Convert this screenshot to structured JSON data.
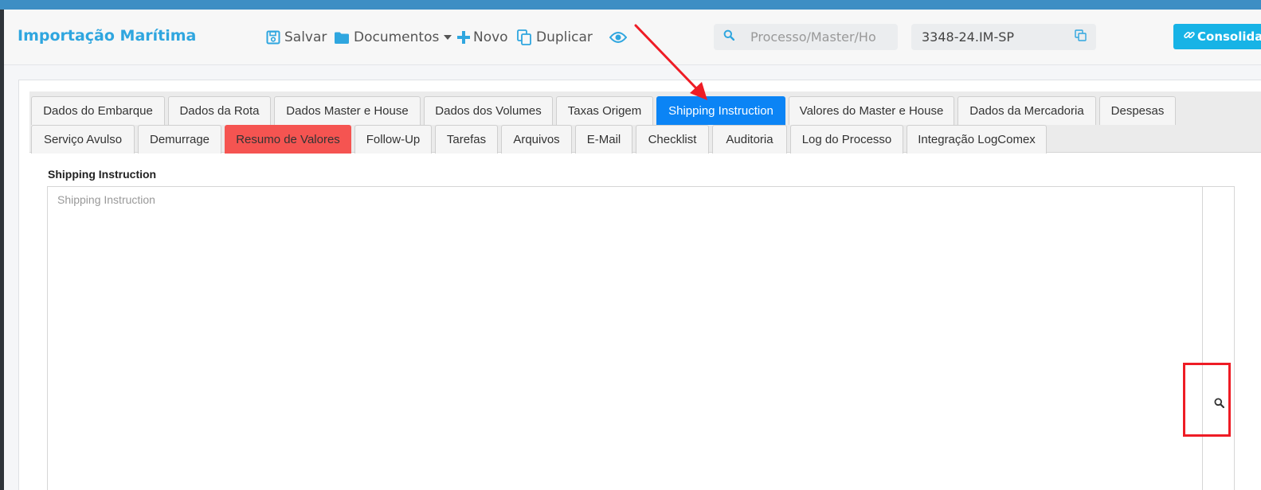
{
  "header": {
    "title": "Importação Marítima",
    "toolbar": {
      "save_label": "Salvar",
      "documents_label": "Documentos",
      "new_label": "Novo",
      "duplicate_label": "Duplicar"
    },
    "search": {
      "placeholder": "Processo/Master/Ho",
      "value": ""
    },
    "process_number": "3348-24.IM-SP",
    "consolidate_label": "Consolidar"
  },
  "tabs": {
    "row1": [
      "Dados do Embarque",
      "Dados da Rota",
      "Dados Master e House",
      "Dados dos Volumes",
      "Taxas Origem",
      "Shipping Instruction",
      "Valores do Master e House",
      "Dados da Mercadoria",
      "Despesas"
    ],
    "row2": [
      "Serviço Avulso",
      "Demurrage",
      "Resumo de Valores",
      "Follow-Up",
      "Tarefas",
      "Arquivos",
      "E-Mail",
      "Checklist",
      "Auditoria",
      "Log do Processo",
      "Integração LogComex"
    ],
    "active": "Shipping Instruction",
    "highlighted": "Resumo de Valores"
  },
  "shipping_instruction": {
    "label": "Shipping Instruction",
    "placeholder": "Shipping Instruction",
    "value": ""
  },
  "icons": {
    "save": "floppy-disk-icon",
    "documents": "folder-icon",
    "new": "plus-icon",
    "duplicate": "copy-icon",
    "preview": "eye-icon",
    "search": "search-icon",
    "copy_process": "copy-icon",
    "consolidate": "link-icon",
    "field_search": "search-icon"
  },
  "colors": {
    "brand": "#2fa6df",
    "accent": "#17b3e6",
    "active_tab": "#0b84f5",
    "danger_tab": "#f55451",
    "annotation": "#ee1c25"
  }
}
